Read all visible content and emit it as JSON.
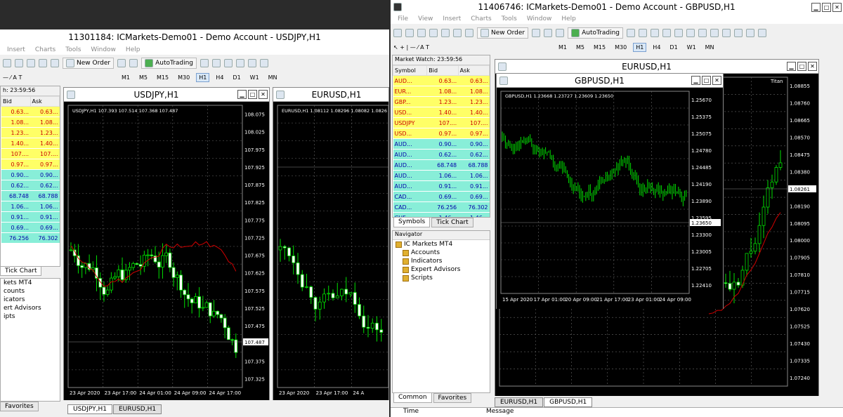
{
  "left": {
    "title": "11301184: ICMarkets-Demo01 - Demo Account - USDJPY,H1",
    "menu": [
      "Insert",
      "Charts",
      "Tools",
      "Window",
      "Help"
    ],
    "toolbar": {
      "new_order": "New Order",
      "autotrading": "AutoTrading"
    },
    "timeframes": [
      "M1",
      "M5",
      "M15",
      "M30",
      "H1",
      "H4",
      "D1",
      "W1",
      "MN"
    ],
    "mw_header": "h: 23:59:56",
    "mw_cols": [
      "Bid",
      "Ask"
    ],
    "mw_rows": [
      [
        "0.63...",
        "0.63...",
        "y"
      ],
      [
        "1.08...",
        "1.08...",
        "y"
      ],
      [
        "1.23...",
        "1.23...",
        "y"
      ],
      [
        "1.40...",
        "1.40...",
        "y"
      ],
      [
        "107....",
        "107....",
        "y"
      ],
      [
        "0.97...",
        "0.97...",
        "y"
      ],
      [
        "0.90...",
        "0.90...",
        "g"
      ],
      [
        "0.62...",
        "0.62...",
        "g"
      ],
      [
        "68.748",
        "68.788",
        "g"
      ],
      [
        "1.06...",
        "1.06...",
        "g"
      ],
      [
        "0.91...",
        "0.91...",
        "g"
      ],
      [
        "0.69...",
        "0.69...",
        "g"
      ],
      [
        "76.256",
        "76.302",
        "g"
      ]
    ],
    "mw_tab": "Tick Chart",
    "nav_items": [
      "kets MT4",
      "counts",
      "icators",
      "ert Advisors",
      "ipts"
    ],
    "favorites_tab": "Favorites",
    "chart1": {
      "title": "USDJPY,H1",
      "header": "USDJPY,H1  107.393 107.514 107.368 107.487",
      "price_labels": [
        "108.075",
        "108.025",
        "107.975",
        "107.925",
        "107.875",
        "107.825",
        "107.775",
        "107.725",
        "107.675",
        "107.625",
        "107.575",
        "107.525",
        "107.475",
        "107.425",
        "107.375",
        "107.325"
      ],
      "current": "107.487",
      "time_labels": [
        "23 Apr 2020",
        "23 Apr 17:00",
        "24 Apr 01:00",
        "24 Apr 09:00",
        "24 Apr 17:00"
      ]
    },
    "chart2": {
      "title": "EURUSD,H1",
      "header": "EURUSD,H1  1.08112 1.08296 1.08082 1.0826",
      "time_labels": [
        "23 Apr 2020",
        "23 Apr 17:00",
        "24 A"
      ]
    },
    "chart_tabs": [
      "USDJPY,H1",
      "EURUSD,H1"
    ]
  },
  "right": {
    "title": "11406746: ICMarkets-Demo01 - Demo Account - GBPUSD,H1",
    "menu": [
      "File",
      "View",
      "Insert",
      "Charts",
      "Tools",
      "Window",
      "Help"
    ],
    "toolbar": {
      "new_order": "New Order",
      "autotrading": "AutoTrading"
    },
    "timeframes": [
      "M1",
      "M5",
      "M15",
      "M30",
      "H1",
      "H4",
      "D1",
      "W1",
      "MN"
    ],
    "mw_header": "Market Watch: 23:59:56",
    "mw_cols": [
      "Symbol",
      "Bid",
      "Ask"
    ],
    "mw_rows": [
      [
        "AUD...",
        "0.63...",
        "0.63...",
        "y"
      ],
      [
        "EUR...",
        "1.08...",
        "1.08...",
        "y"
      ],
      [
        "GBP...",
        "1.23...",
        "1.23...",
        "y"
      ],
      [
        "USD...",
        "1.40...",
        "1.40...",
        "y"
      ],
      [
        "USDJPY",
        "107....",
        "107....",
        "y"
      ],
      [
        "USD...",
        "0.97...",
        "0.97...",
        "y"
      ],
      [
        "AUD...",
        "0.90...",
        "0.90...",
        "g"
      ],
      [
        "AUD...",
        "0.62...",
        "0.62...",
        "g"
      ],
      [
        "AUD...",
        "68.748",
        "68.788",
        "g"
      ],
      [
        "AUD...",
        "1.06...",
        "1.06...",
        "g"
      ],
      [
        "AUD...",
        "0.91...",
        "0.91...",
        "g"
      ],
      [
        "CAD...",
        "0.69...",
        "0.69...",
        "g"
      ],
      [
        "CAD...",
        "76.256",
        "76.302",
        "g"
      ],
      [
        "CHF...",
        "1.46...",
        "1.46...",
        "g"
      ]
    ],
    "mw_tabs": [
      "Symbols",
      "Tick Chart"
    ],
    "navigator": {
      "title": "Navigator",
      "items": [
        "IC Markets MT4",
        "Accounts",
        "Indicators",
        "Expert Advisors",
        "Scripts"
      ]
    },
    "nav_tabs": [
      "Common",
      "Favorites"
    ],
    "back_chart": {
      "title": "EURUSD,H1",
      "price_labels": [
        "1.08855",
        "1.08760",
        "1.08665",
        "1.08570",
        "1.08475",
        "1.08380",
        "1.08285",
        "1.08190",
        "1.08095",
        "1.08000",
        "1.07905",
        "1.07810",
        "1.07715",
        "1.07620",
        "1.07525",
        "1.07430",
        "1.07335",
        "1.07240"
      ],
      "current": "1.08261",
      "badge": "Titan"
    },
    "front_chart": {
      "title": "GBPUSD,H1",
      "header": "GBPUSD,H1  1.23668 1.23727 1.23609 1.23650",
      "price_labels": [
        "1.25670",
        "1.25375",
        "1.25075",
        "1.24780",
        "1.24485",
        "1.24190",
        "1.23890",
        "1.23595",
        "1.23300",
        "1.23005",
        "1.22705",
        "1.22410"
      ],
      "current": "1.23650",
      "time_labels": [
        "15 Apr 2020",
        "17 Apr 01:00",
        "20 Apr 09:00",
        "21 Apr 17:00",
        "23 Apr 01:00",
        "24 Apr 09:00"
      ]
    },
    "chart_tabs": [
      "EURUSD,H1",
      "GBPUSD,H1"
    ],
    "terminal_cols": [
      "Time",
      "Message"
    ]
  }
}
